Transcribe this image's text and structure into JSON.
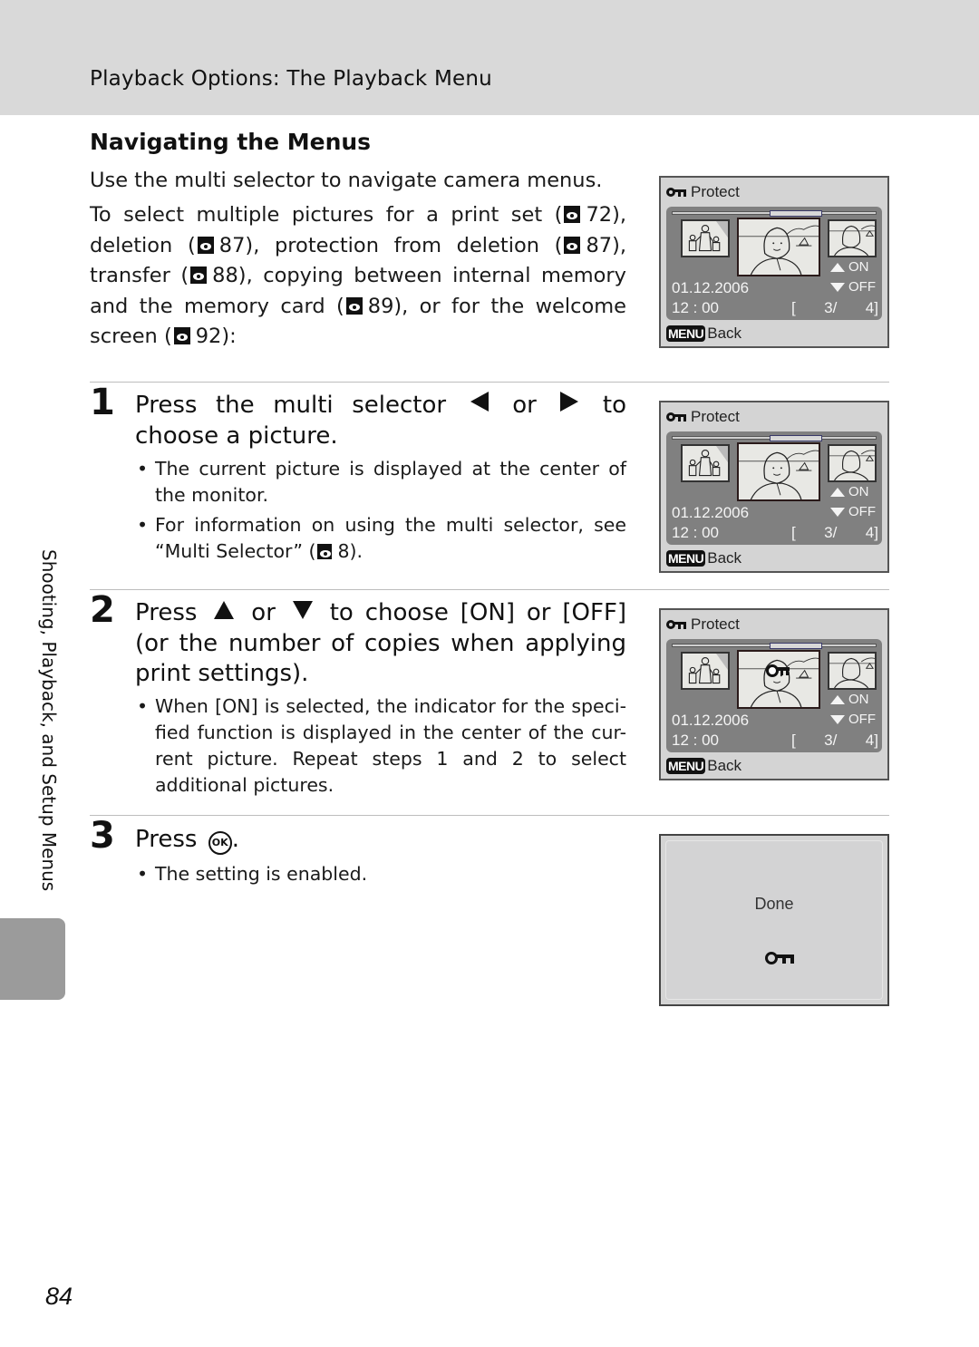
{
  "header": {
    "title": "Playback Options: The Playback Menu"
  },
  "section": {
    "title": "Navigating the Menus",
    "intro1": "Use the multi selector to navigate camera menus.",
    "intro2_parts": {
      "p1": "To select multiple pictures for a print set (",
      "r1": "72), deletion (",
      "r2": "87), protection from deletion (",
      "r3": "87), transfer (",
      "r4": "88), copying between internal memory and the memory card (",
      "r5": "89), or for the welcome screen (",
      "r6": "92):"
    }
  },
  "steps": [
    {
      "number": "1",
      "heading_parts": {
        "a": "Press the multi selector",
        "b": "or",
        "c": "to choose a picture."
      },
      "bullets": [
        "The current picture is displayed at the center of the monitor.",
        {
          "text": "For information on using the multi selector, see “Multi Selector” (",
          "ref": "8)."
        }
      ]
    },
    {
      "number": "2",
      "heading_parts": {
        "a": "Press",
        "b": "or",
        "c": "to choose [ON] or [OFF] (or the number of copies when applying print settings)."
      },
      "bullets": [
        "When [ON] is selected, the indicator for the speci-fied function is displayed in the center of the cur-rent picture. Repeat steps 1 and 2 to select additional pictures."
      ]
    },
    {
      "number": "3",
      "heading_parts": {
        "a": "Press",
        "ok": "OK",
        "c": "."
      },
      "bullets": [
        "The setting is enabled."
      ]
    }
  ],
  "camera_screens": [
    {
      "title": "Protect",
      "on_label": "ON",
      "off_label": "OFF",
      "date": "01.12.2006",
      "time": "12 : 00",
      "count_open": "[",
      "count_current": "3/",
      "count_total": "4]",
      "menu_label": "MENU",
      "back_label": "Back",
      "protected_overlay": false
    },
    {
      "title": "Protect",
      "on_label": "ON",
      "off_label": "OFF",
      "date": "01.12.2006",
      "time": "12 : 00",
      "count_open": "[",
      "count_current": "3/",
      "count_total": "4]",
      "menu_label": "MENU",
      "back_label": "Back",
      "protected_overlay": false
    },
    {
      "title": "Protect",
      "on_label": "ON",
      "off_label": "OFF",
      "date": "01.12.2006",
      "time": "12 : 00",
      "count_open": "[",
      "count_current": "3/",
      "count_total": "4]",
      "menu_label": "MENU",
      "back_label": "Back",
      "protected_overlay": true
    }
  ],
  "done_screen": {
    "text": "Done"
  },
  "side_tab": {
    "label": "Shooting, Playback, and Setup Menus"
  },
  "page_number": "84",
  "colors": {
    "header_band": "#d9d9d9",
    "side_tab": "#9b9b9b",
    "camera_panel": "#808080",
    "camera_bg": "#d4d4d4"
  }
}
